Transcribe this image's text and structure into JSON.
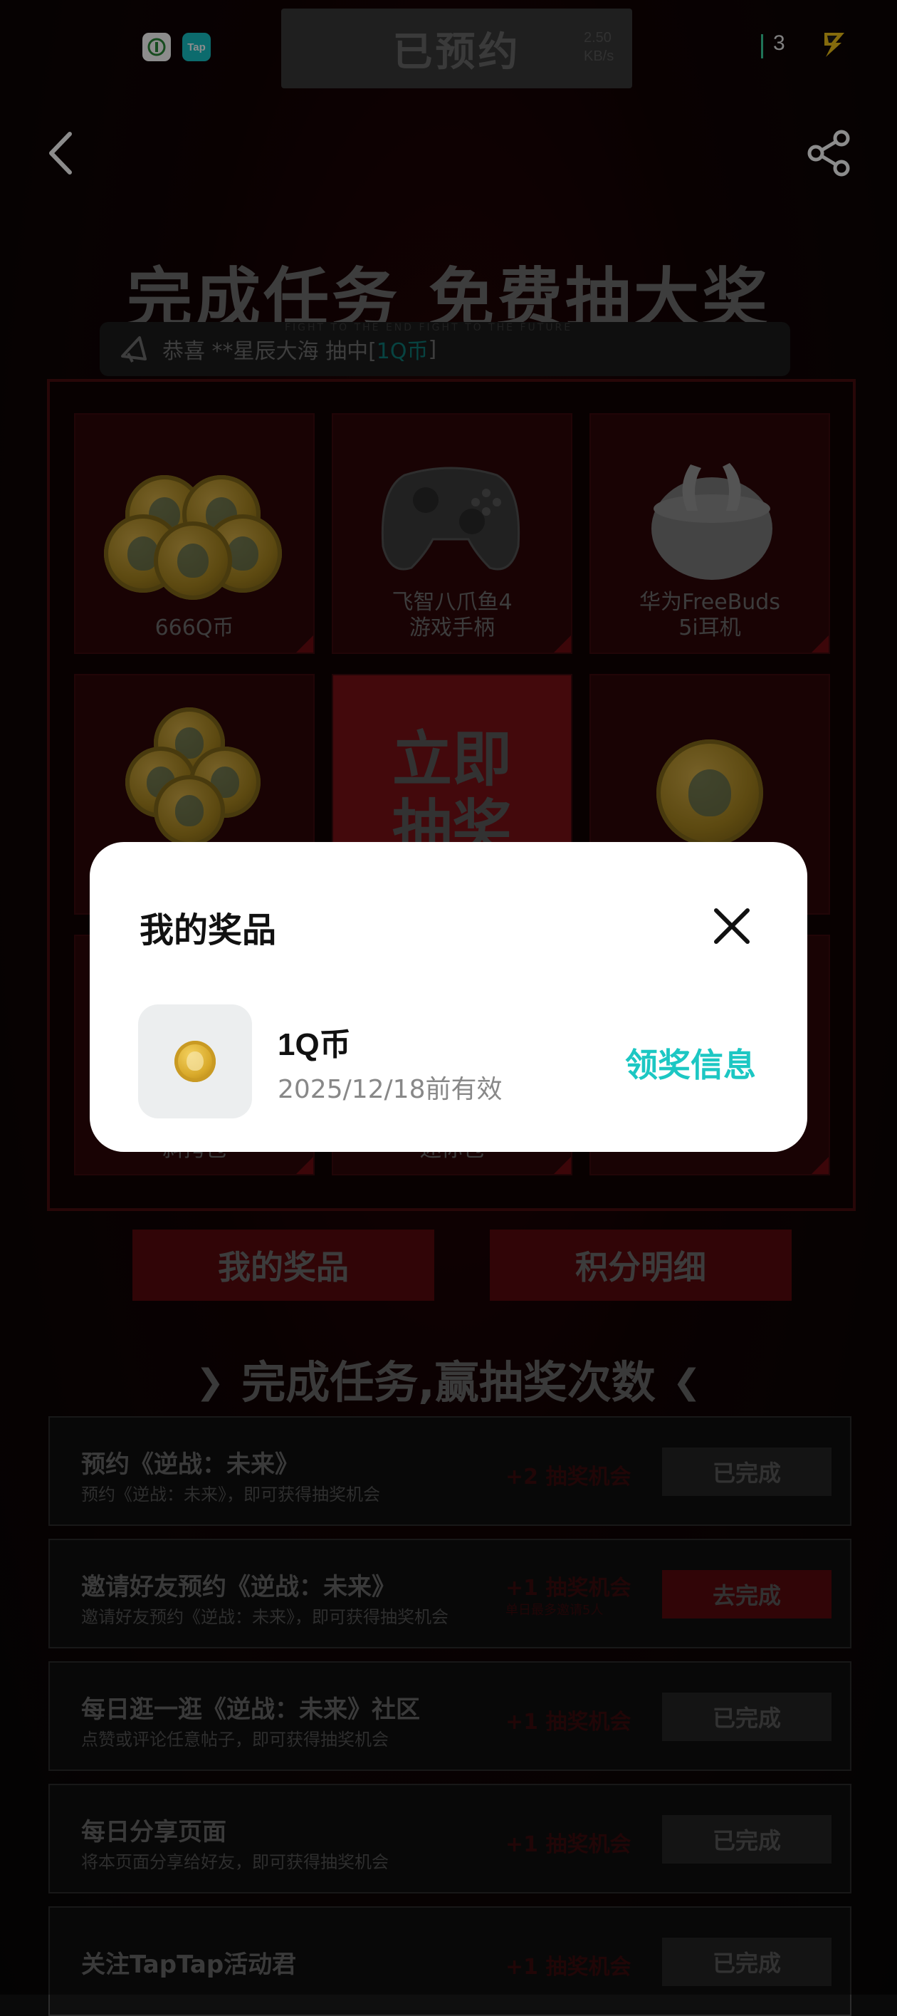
{
  "status_bar": {
    "reserved_text": "已预约",
    "net_speed_value": "2.50",
    "net_speed_unit": "KB/s",
    "battery_level": "3"
  },
  "header": {
    "headline_left": "完成任务",
    "headline_right": "免费抽大奖",
    "tagline": "FIGHT TO THE END  FIGHT TO THE FUTURE",
    "marquee_prefix": "恭喜 **星辰大海 抽中[ ",
    "marquee_prize": "1Q币",
    "marquee_suffix": " ]"
  },
  "prize_grid": [
    {
      "label": "666Q币"
    },
    {
      "label": "飞智八爪鱼4\n游戏手柄"
    },
    {
      "label": "华为FreeBuds\n5i耳机"
    },
    {
      "label": "斜挎包"
    },
    {
      "label": "迷你包"
    }
  ],
  "draw_button": "立即\n抽奖",
  "bottom_buttons": {
    "my_prizes": "我的奖品",
    "points_detail": "积分明细"
  },
  "tasks_section_title": "完成任务,赢抽奖次数",
  "tasks": [
    {
      "title": "预约《逆战：未来》",
      "desc": "预约《逆战：未来》，即可获得抽奖机会",
      "reward": "+2 抽奖机会",
      "sub": "",
      "button": "已完成",
      "status": "done"
    },
    {
      "title": "邀请好友预约《逆战：未来》",
      "desc": "邀请好友预约《逆战：未来》，即可获得抽奖机会",
      "reward": "+1 抽奖机会",
      "sub": "单日最多邀请5人",
      "button": "去完成",
      "status": "todo"
    },
    {
      "title": "每日逛一逛《逆战：未来》社区",
      "desc": "点赞或评论任意帖子，即可获得抽奖机会",
      "reward": "+1 抽奖机会",
      "sub": "",
      "button": "已完成",
      "status": "done"
    },
    {
      "title": "每日分享页面",
      "desc": "将本页面分享给好友，即可获得抽奖机会",
      "reward": "+1 抽奖机会",
      "sub": "",
      "button": "已完成",
      "status": "done"
    },
    {
      "title": "关注TapTap活动君",
      "desc": "",
      "reward": "+1 抽奖机会",
      "sub": "",
      "button": "已完成",
      "status": "done"
    }
  ],
  "modal": {
    "title": "我的奖品",
    "prize_name_num": "1Q",
    "prize_name_unit": "币",
    "prize_expiry": "2025/12/18前有效",
    "claim_label": "领奖信息"
  },
  "colors": {
    "accent_teal": "#1cc7c3",
    "brand_red": "#7b1116",
    "modal_bg": "#ffffff"
  }
}
